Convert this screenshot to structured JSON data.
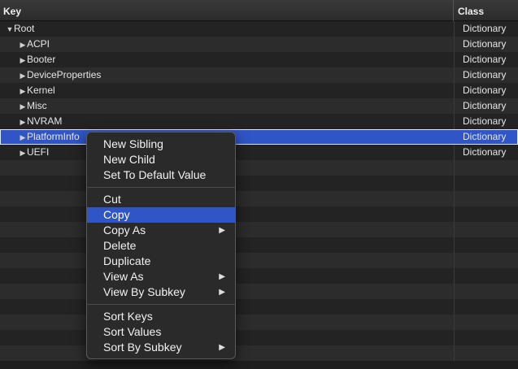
{
  "header": {
    "key_label": "Key",
    "class_label": "Class"
  },
  "rows": [
    {
      "key": "Root",
      "class": "Dictionary",
      "expander": "expanded-triangle-icon"
    },
    {
      "key": "ACPI",
      "class": "Dictionary",
      "expander": "collapsed-triangle-icon"
    },
    {
      "key": "Booter",
      "class": "Dictionary",
      "expander": "collapsed-triangle-icon"
    },
    {
      "key": "DeviceProperties",
      "class": "Dictionary",
      "expander": "collapsed-triangle-icon"
    },
    {
      "key": "Kernel",
      "class": "Dictionary",
      "expander": "collapsed-triangle-icon"
    },
    {
      "key": "Misc",
      "class": "Dictionary",
      "expander": "collapsed-triangle-icon"
    },
    {
      "key": "NVRAM",
      "class": "Dictionary",
      "expander": "collapsed-triangle-icon"
    },
    {
      "key": "PlatformInfo",
      "class": "Dictionary",
      "expander": "collapsed-triangle-icon"
    },
    {
      "key": "UEFI",
      "class": "Dictionary",
      "expander": "collapsed-triangle-icon"
    }
  ],
  "context_menu": {
    "items": [
      "New Sibling",
      "New Child",
      "Set To Default Value",
      "Cut",
      "Copy",
      "Copy As",
      "Delete",
      "Duplicate",
      "View As",
      "View By Subkey",
      "Sort Keys",
      "Sort Values",
      "Sort By Subkey"
    ],
    "highlighted": "Copy",
    "submenu_icon": "submenu-arrow-icon"
  },
  "colors": {
    "selection": "#2f55c6",
    "row_dark": "#232323",
    "row_light": "#2c2c2c"
  }
}
